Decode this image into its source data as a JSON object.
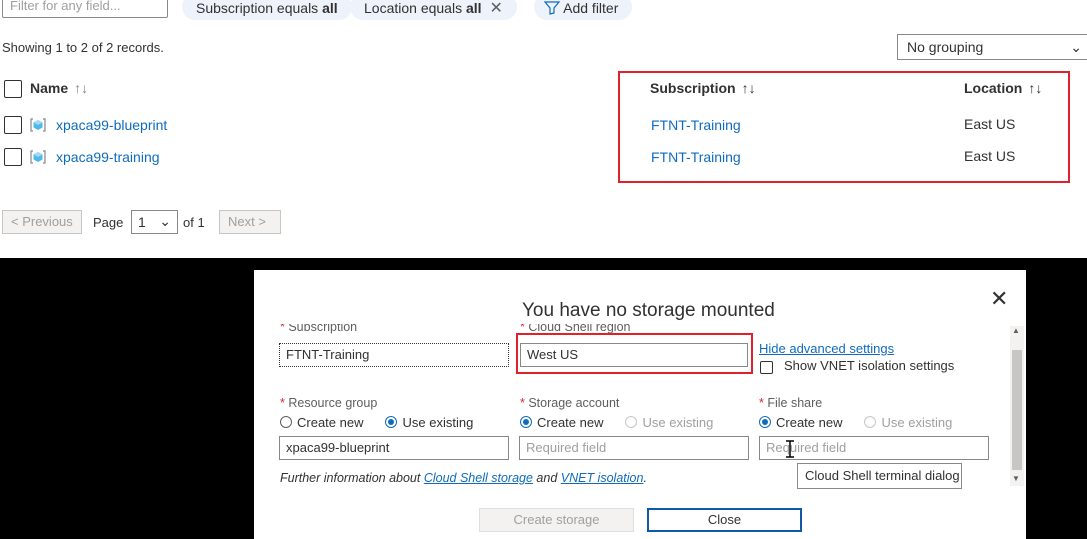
{
  "toolbar": {
    "filter_placeholder": "Filter for any field...",
    "pill_subscription_prefix": "Subscription equals ",
    "pill_subscription_value": "all",
    "pill_location_prefix": "Location equals ",
    "pill_location_value": "all",
    "add_filter": "Add filter"
  },
  "records": {
    "showing": "Showing 1 to 2 of 2 records.",
    "grouping": "No grouping"
  },
  "table": {
    "headers": {
      "name": "Name",
      "subscription": "Subscription",
      "location": "Location"
    },
    "sort_glyph_name": "↑↓",
    "sort_glyph": "↑↓",
    "rows": [
      {
        "name": "xpaca99-blueprint",
        "subscription": "FTNT-Training",
        "location": "East US"
      },
      {
        "name": "xpaca99-training",
        "subscription": "FTNT-Training",
        "location": "East US"
      }
    ]
  },
  "pager": {
    "previous": "< Previous",
    "page_label": "Page",
    "page_value": "1",
    "of_label": "of 1",
    "next": "Next >"
  },
  "dialog": {
    "title": "You have no storage mounted",
    "subscription_label": "Subscription",
    "subscription_value": "FTNT-Training",
    "region_label": "Cloud Shell region",
    "region_value": "West US",
    "hide_advanced": "Hide advanced settings",
    "vnet_label": "Show VNET isolation settings",
    "resource_group_label": "Resource group",
    "storage_account_label": "Storage account",
    "file_share_label": "File share",
    "create_new": "Create new",
    "use_existing": "Use existing",
    "resource_group_value": "xpaca99-blueprint",
    "required_placeholder": "Required field",
    "required_placeholder_file": "Required field",
    "info_prefix": "Further information about ",
    "info_link1": "Cloud Shell storage",
    "info_mid": " and ",
    "info_link2": "VNET isolation",
    "info_suffix": ".",
    "tooltip": "Cloud Shell terminal dialog",
    "create_storage": "Create storage",
    "close": "Close"
  },
  "colors": {
    "accent": "#0f6cbd",
    "highlight": "#e0202a"
  },
  "icons": [
    "funnel-icon",
    "close-icon",
    "chevron-down-icon",
    "resource-group-icon",
    "sort-icon",
    "text-cursor-icon"
  ]
}
